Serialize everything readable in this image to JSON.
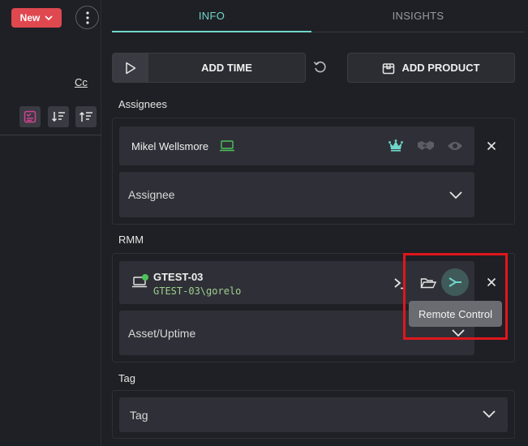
{
  "header": {
    "new_label": "New",
    "tabs": [
      {
        "label": "INFO",
        "active": true
      },
      {
        "label": "INSIGHTS",
        "active": false
      }
    ]
  },
  "left": {
    "cc_label": "Cc"
  },
  "actions": {
    "add_time_label": "ADD TIME",
    "add_product_label": "ADD PRODUCT"
  },
  "assignees": {
    "section_label": "Assignees",
    "items": [
      {
        "name": "Mikel Wellsmore"
      }
    ],
    "select_placeholder": "Assignee"
  },
  "rmm": {
    "section_label": "RMM",
    "device": {
      "name": "GTEST-03",
      "user": "GTEST-03\\gorelo"
    },
    "tooltip": "Remote Control",
    "select_placeholder": "Asset/Uptime"
  },
  "tag": {
    "section_label": "Tag",
    "select_placeholder": "Tag"
  },
  "colors": {
    "accent": "#6fd6c9",
    "new_button": "#e0484f",
    "online_dot": "#4fc35a",
    "highlight": "#e0161c",
    "crown": "#6fd6c9",
    "tool_active": "#d1428f"
  },
  "icons": [
    "chevron-down-icon",
    "kebab-icon",
    "checklist-icon",
    "sort-desc-icon",
    "sort-asc-icon",
    "play-icon",
    "undo-icon",
    "box-icon",
    "laptop-icon",
    "crown-icon",
    "handshake-icon",
    "eye-icon",
    "close-icon",
    "terminal-icon",
    "folder-open-icon",
    "remote-control-icon"
  ]
}
